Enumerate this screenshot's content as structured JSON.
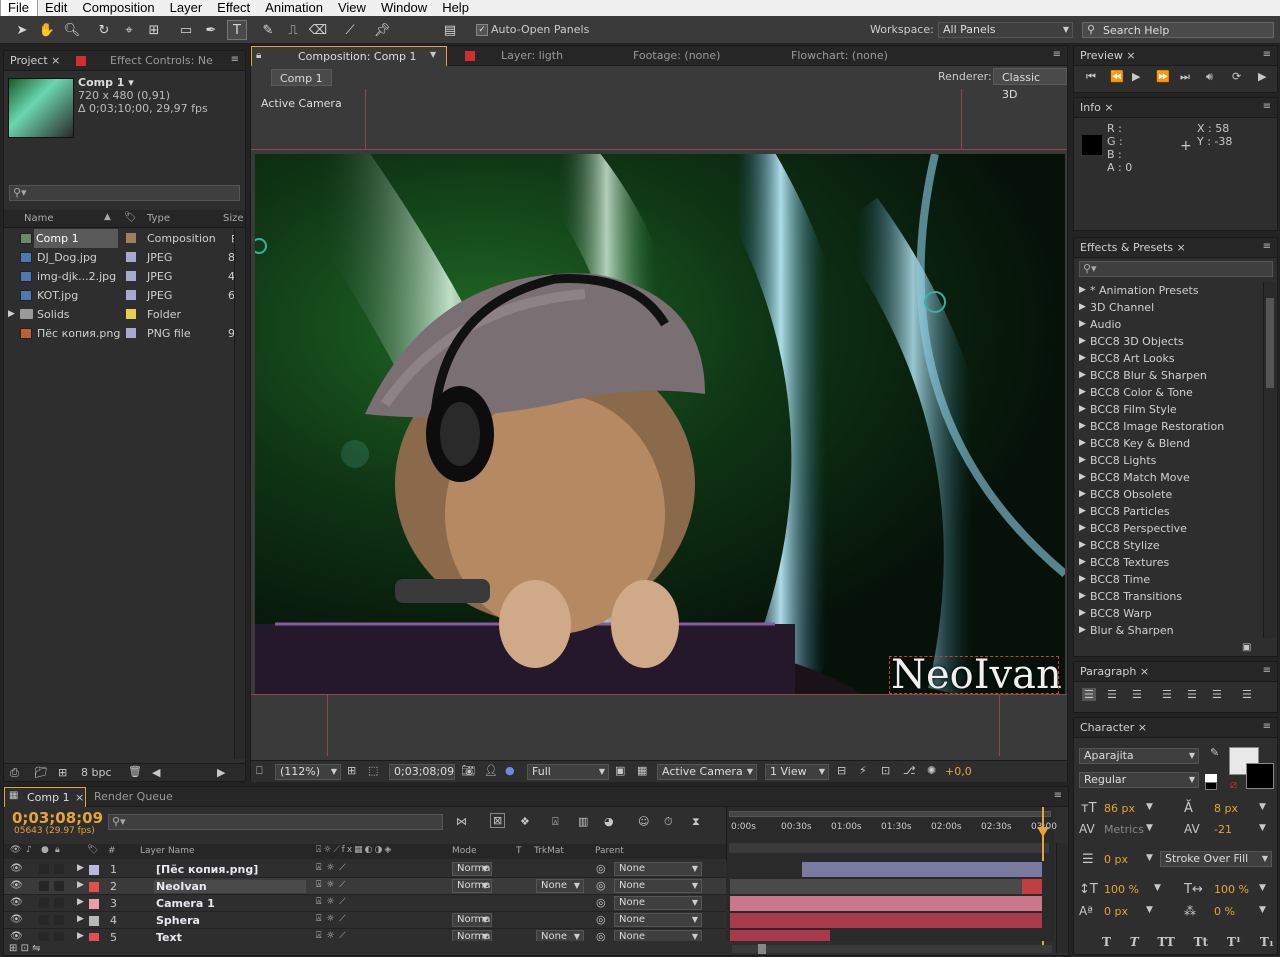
{
  "menu": [
    "File",
    "Edit",
    "Composition",
    "Layer",
    "Effect",
    "Animation",
    "View",
    "Window",
    "Help"
  ],
  "toolbar": {
    "auto_open_label": "Auto-Open Panels",
    "workspace_label": "Workspace:",
    "workspace_value": "All Panels",
    "search_placeholder": "Search Help"
  },
  "project": {
    "tab_project": "Project",
    "tab_effect": "Effect Controls: Ne",
    "comp_name": "Comp 1 ▾",
    "comp_size": "720 x 480 (0,91)",
    "comp_duration": "Δ 0;03;10;00, 29,97 fps",
    "col_name": "Name",
    "col_type": "Type",
    "col_size": "Size",
    "items": [
      {
        "name": "Comp 1",
        "type": "Composition",
        "size": ""
      },
      {
        "name": "DJ_Dog.jpg",
        "type": "JPEG",
        "size": "8"
      },
      {
        "name": "img-djk...2.jpg",
        "type": "JPEG",
        "size": "4"
      },
      {
        "name": "KOT.jpg",
        "type": "JPEG",
        "size": "6"
      },
      {
        "name": "Solids",
        "type": "Folder",
        "size": ""
      },
      {
        "name": "Пёс копия.png",
        "type": "PNG file",
        "size": "9"
      }
    ],
    "bpc": "8 bpc"
  },
  "composition": {
    "tab_comp": "Composition: Comp 1",
    "tab_layer": "Layer: ligth",
    "tab_footage": "Footage: (none)",
    "tab_flow": "Flowchart: (none)",
    "breadcrumb": "Comp 1",
    "renderer_label": "Renderer:",
    "renderer_value": "Classic 3D",
    "active_camera": "Active Camera",
    "overlay_text": "NeoIvan",
    "zoom": "(112%)",
    "timecode": "0;03;08;09",
    "resolution": "Full",
    "camera": "Active Camera",
    "views": "1 View",
    "exposure": "+0,0"
  },
  "preview": {
    "title": "Preview"
  },
  "info": {
    "title": "Info",
    "r": "R :",
    "g": "G :",
    "b": "B :",
    "a": "A : 0",
    "x": "X : 58",
    "y": "Y : -38"
  },
  "effects": {
    "title": "Effects & Presets",
    "items": [
      "* Animation Presets",
      "3D Channel",
      "Audio",
      "BCC8 3D Objects",
      "BCC8 Art Looks",
      "BCC8 Blur & Sharpen",
      "BCC8 Color & Tone",
      "BCC8 Film Style",
      "BCC8 Image Restoration",
      "BCC8 Key & Blend",
      "BCC8 Lights",
      "BCC8 Match Move",
      "BCC8 Obsolete",
      "BCC8 Particles",
      "BCC8 Perspective",
      "BCC8 Stylize",
      "BCC8 Textures",
      "BCC8 Time",
      "BCC8 Transitions",
      "BCC8 Warp",
      "Blur & Sharpen"
    ]
  },
  "paragraph": {
    "title": "Paragraph"
  },
  "character": {
    "title": "Character",
    "font": "Aparajita",
    "style": "Regular",
    "size": "86 px",
    "leading": "8 px",
    "kerning": "Metrics",
    "tracking": "-21",
    "stroke_width": "0 px",
    "stroke_mode": "Stroke Over Fill",
    "vscale": "100 %",
    "hscale": "100 %",
    "baseline": "0 px",
    "tsume": "0 %",
    "styles": [
      "T",
      "T",
      "TT",
      "Tt",
      "T¹",
      "T₁"
    ]
  },
  "timeline": {
    "tab_comp": "Comp 1",
    "tab_render": "Render Queue",
    "timecode": "0;03;08;09",
    "frames": "05643 (29.97 fps)",
    "col_num": "#",
    "col_layer": "Layer Name",
    "col_mode": "Mode",
    "col_t": "T",
    "col_trkmat": "TrkMat",
    "col_parent": "Parent",
    "ruler": [
      "0:00s",
      "00:30s",
      "01:00s",
      "01:30s",
      "02:00s",
      "02:30s",
      "03:00"
    ],
    "layers": [
      {
        "num": "1",
        "name": "[Пёс копия.png]",
        "mode": "Norma",
        "trkmat": "",
        "parent": "None",
        "color": "#b8b8e0"
      },
      {
        "num": "2",
        "name": "NeoIvan",
        "mode": "Norma",
        "trkmat": "None",
        "parent": "None",
        "color": "#e05050"
      },
      {
        "num": "3",
        "name": "Camera 1",
        "mode": "",
        "trkmat": "",
        "parent": "None",
        "color": "#e8a0a8"
      },
      {
        "num": "4",
        "name": "Sphera",
        "mode": "Norma",
        "trkmat": "",
        "parent": "None",
        "color": "#b8b8b8"
      },
      {
        "num": "5",
        "name": "Text",
        "mode": "Norma",
        "trkmat": "None",
        "parent": "None",
        "color": "#e05050"
      }
    ]
  }
}
